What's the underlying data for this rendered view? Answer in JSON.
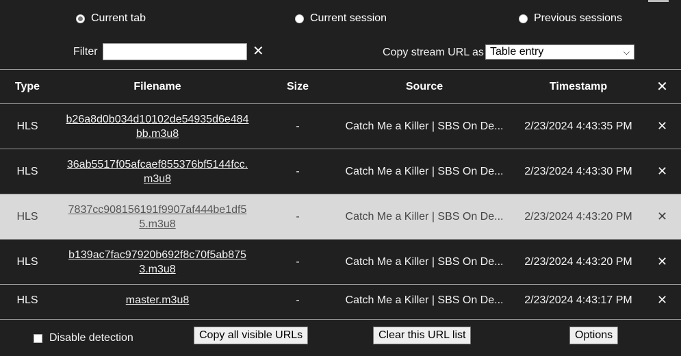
{
  "scope": {
    "options": [
      {
        "label": "Current tab",
        "checked": true
      },
      {
        "label": "Current session",
        "checked": false
      },
      {
        "label": "Previous sessions",
        "checked": false
      }
    ]
  },
  "filter": {
    "label": "Filter",
    "value": "",
    "clear_icon": "✕"
  },
  "copy": {
    "label": "Copy stream URL as",
    "selected": "Table entry"
  },
  "table": {
    "headers": [
      "Type",
      "Filename",
      "Size",
      "Source",
      "Timestamp"
    ],
    "clear_all_icon": "✕",
    "rows": [
      {
        "type": "HLS",
        "filename": "b26a8d0b034d10102de54935d6e484bb.m3u8",
        "size": "-",
        "source": "Catch Me a Killer | SBS On De...",
        "timestamp": "2/23/2024 4:43:35 PM",
        "remove": "✕"
      },
      {
        "type": "HLS",
        "filename": "36ab5517f05afcaef855376bf5144fcc.m3u8",
        "size": "-",
        "source": "Catch Me a Killer | SBS On De...",
        "timestamp": "2/23/2024 4:43:30 PM",
        "remove": "✕"
      },
      {
        "type": "HLS",
        "filename": "7837cc908156191f9907af444be1df55.m3u8",
        "size": "-",
        "source": "Catch Me a Killer | SBS On De...",
        "timestamp": "2/23/2024 4:43:20 PM",
        "remove": "✕"
      },
      {
        "type": "HLS",
        "filename": "b139ac7fac97920b692f8c70f5ab8753.m3u8",
        "size": "-",
        "source": "Catch Me a Killer | SBS On De...",
        "timestamp": "2/23/2024 4:43:20 PM",
        "remove": "✕"
      },
      {
        "type": "HLS",
        "filename": "master.m3u8",
        "size": "-",
        "source": "Catch Me a Killer | SBS On De...",
        "timestamp": "2/23/2024 4:43:17 PM",
        "remove": "✕"
      }
    ]
  },
  "footer": {
    "disable_detection_label": "Disable detection",
    "copy_all_label": "Copy all visible URLs",
    "clear_list_label": "Clear this URL list",
    "options_label": "Options"
  }
}
